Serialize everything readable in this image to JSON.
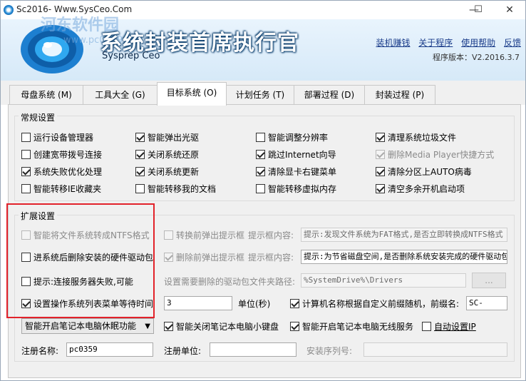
{
  "window": {
    "title": "Sc2016- Www.SysCeo.Com",
    "minimize": "—",
    "maximize": "☐",
    "close": "✕"
  },
  "header": {
    "app_name": "系统封装首席执行官",
    "app_subtitle": "Sysprep Ceo",
    "watermark": "河东软件园",
    "watermark_url": "www.pc0359.cn",
    "links": [
      "装机赚钱",
      "关于程序",
      "使用帮助",
      "反馈"
    ],
    "version": "程序版本：V2.2016.3.7"
  },
  "tabs": [
    "母盘系统 (M)",
    "工具大全 (G)",
    "目标系统 (O)",
    "计划任务 (T)",
    "部署过程 (D)",
    "封装过程 (P)"
  ],
  "general": {
    "title": "常规设置",
    "items": [
      {
        "label": "运行设备管理器",
        "checked": false
      },
      {
        "label": "智能弹出光驱",
        "checked": true
      },
      {
        "label": "智能调整分辨率",
        "checked": false
      },
      {
        "label": "清理系统垃圾文件",
        "checked": true
      },
      {
        "label": "创建宽带拨号连接",
        "checked": false
      },
      {
        "label": "关闭系统还原",
        "checked": true
      },
      {
        "label": "跳过Internet向导",
        "checked": true
      },
      {
        "label": "删除Media Player快捷方式",
        "checked": true
      },
      {
        "label": "系统失败优化处理",
        "checked": true
      },
      {
        "label": "关闭系统更新",
        "checked": true
      },
      {
        "label": "清除显卡右键菜单",
        "checked": true
      },
      {
        "label": "清除分区上AUTO病毒",
        "checked": true
      },
      {
        "label": "智能转移IE收藏夹",
        "checked": false
      },
      {
        "label": "智能转移我的文档",
        "checked": false
      },
      {
        "label": "智能转移虚拟内存",
        "checked": false
      },
      {
        "label": "清空多余开机启动项",
        "checked": true
      }
    ]
  },
  "extended": {
    "title": "扩展设置",
    "ntfs": "智能将文件系统转成NTFS格式",
    "delete_driver": "进系统后删除安装的硬件驱动包",
    "connect_fail": "提示:连接服务器失败,可能",
    "boot_menu_wait": "设置操作系统列表菜单等待时间",
    "convert_prompt": "转换前弹出提示框",
    "prompt_content_label": "提示框内容:",
    "convert_prompt_text": "提示:发现文件系统为FAT格式,是否立即转换成NTFS格式",
    "delete_prompt": "删除前弹出提示框",
    "delete_prompt_text": "提示:为节省磁盘空间,是否删除系统安装完成的硬件驱动包",
    "driver_path_label": "设置需要删除的驱动包文件夹路径:",
    "driver_path": "%SystemDrive%\\Drivers",
    "browse": "...",
    "wait_time": "3",
    "unit_label": "单位(秒)",
    "random_name": "计算机名称根据自定义前缀随机，前缀名:",
    "prefix": "SC-",
    "sleep_select": "智能开启笔记本电脑休眠功能",
    "close_keyboard": "智能关闭笔记本电脑小键盘",
    "wireless": "智能开启笔记本电脑无线服务",
    "auto_ip": "自动设置IP",
    "reg_name_label": "注册名称:",
    "reg_name": "pc0359",
    "reg_unit_label": "注册单位:",
    "reg_unit": "",
    "serial_label": "安装序列号:",
    "serial": ""
  }
}
